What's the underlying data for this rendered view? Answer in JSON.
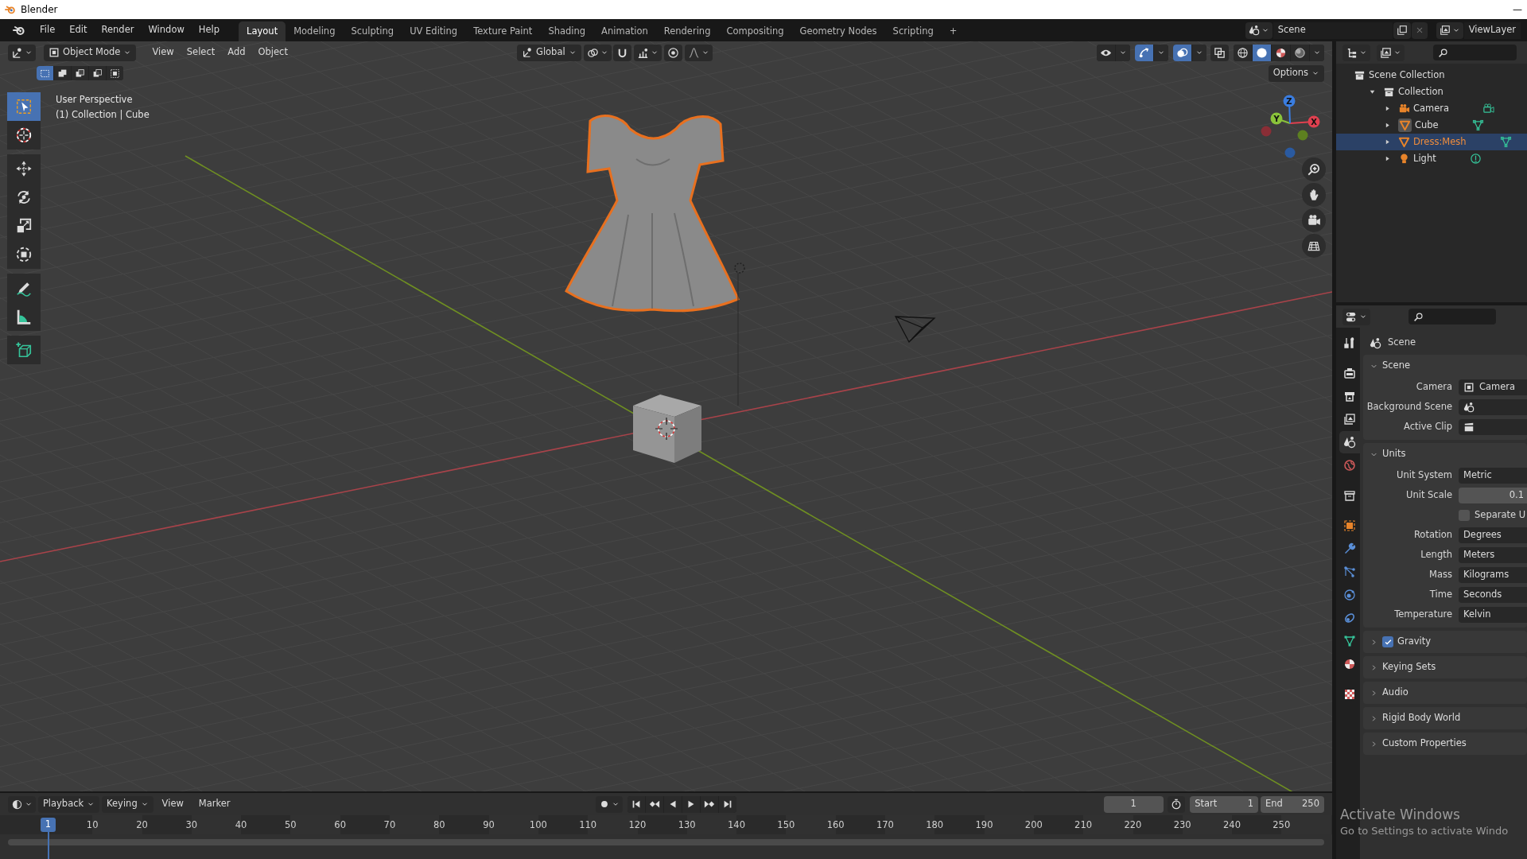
{
  "window": {
    "title": "Blender",
    "minimize": "—"
  },
  "menu_bar": {
    "menus": [
      "File",
      "Edit",
      "Render",
      "Window",
      "Help"
    ],
    "workspaces": [
      {
        "label": "Layout",
        "selected": true
      },
      {
        "label": "Modeling",
        "selected": false
      },
      {
        "label": "Sculpting",
        "selected": false
      },
      {
        "label": "UV Editing",
        "selected": false
      },
      {
        "label": "Texture Paint",
        "selected": false
      },
      {
        "label": "Shading",
        "selected": false
      },
      {
        "label": "Animation",
        "selected": false
      },
      {
        "label": "Rendering",
        "selected": false
      },
      {
        "label": "Compositing",
        "selected": false
      },
      {
        "label": "Geometry Nodes",
        "selected": false
      },
      {
        "label": "Scripting",
        "selected": false
      }
    ],
    "add_workspace": "+",
    "scene": "Scene",
    "view_layer": "ViewLayer"
  },
  "viewport": {
    "header": {
      "mode": "Object Mode",
      "menus": [
        "View",
        "Select",
        "Add",
        "Object"
      ],
      "orientation": "Global",
      "toggles": [
        {
          "kind": "visibility",
          "selected": false
        },
        {
          "kind": "gizmo",
          "selected": true
        },
        {
          "kind": "overlay",
          "selected": true
        },
        {
          "kind": "xray",
          "selected": false
        }
      ],
      "shading": [
        {
          "kind": "wireframe",
          "selected": false
        },
        {
          "kind": "solid",
          "selected": true
        },
        {
          "kind": "material",
          "selected": false
        },
        {
          "kind": "rendered",
          "selected": false
        }
      ],
      "select_modes": [
        {
          "kind": "set",
          "selected": true
        },
        {
          "kind": "extend",
          "selected": false
        },
        {
          "kind": "subtract",
          "selected": false
        },
        {
          "kind": "difference",
          "selected": false
        },
        {
          "kind": "intersect",
          "selected": false
        }
      ],
      "options": "Options"
    },
    "overlay_text": [
      "User Perspective",
      "(1) Collection | Cube"
    ],
    "tools": [
      {
        "kind": "select",
        "selected": true
      },
      {
        "kind": "cursor",
        "selected": false
      },
      {
        "kind": "move",
        "selected": false
      },
      {
        "kind": "rotate",
        "selected": false
      },
      {
        "kind": "scale",
        "selected": false
      },
      {
        "kind": "transform",
        "selected": false
      },
      {
        "kind": "annotate",
        "selected": false
      },
      {
        "kind": "measure",
        "selected": false
      },
      {
        "kind": "add_cube",
        "selected": false
      }
    ],
    "gizmo_axes": [
      "X",
      "Y",
      "Z"
    ]
  },
  "timeline": {
    "menus": [
      {
        "label": "Playback",
        "kind": "dropdown"
      },
      {
        "label": "Keying",
        "kind": "dropdown"
      },
      {
        "label": "View",
        "kind": "menu"
      },
      {
        "label": "Marker",
        "kind": "menu"
      }
    ],
    "frame": "1",
    "start_label": "Start",
    "start": "1",
    "end_label": "End",
    "end": "250",
    "ruler": {
      "current": "1",
      "labels": [
        "10",
        "20",
        "30",
        "40",
        "50",
        "60",
        "70",
        "80",
        "90",
        "100",
        "110",
        "120",
        "130",
        "140",
        "150",
        "160",
        "170",
        "180",
        "190",
        "200",
        "210",
        "220",
        "230",
        "240",
        "250"
      ]
    }
  },
  "outliner": {
    "tree": [
      {
        "label": "Scene Collection",
        "kind": "scene_collection",
        "children": [
          {
            "label": "Collection",
            "kind": "collection",
            "expanded": true,
            "children": [
              {
                "label": "Camera",
                "kind": "camera",
                "expanded": false,
                "selected": false,
                "active": false
              },
              {
                "label": "Cube",
                "kind": "mesh",
                "expanded": false,
                "selected": false,
                "active": true
              },
              {
                "label": "Dress:Mesh",
                "kind": "mesh",
                "expanded": false,
                "selected": true,
                "active": false
              },
              {
                "label": "Light",
                "kind": "light",
                "expanded": false,
                "selected": false,
                "active": false
              }
            ]
          }
        ]
      }
    ]
  },
  "properties": {
    "tabs": [
      {
        "kind": "tool",
        "selected": false
      },
      {
        "kind": "render",
        "selected": false
      },
      {
        "kind": "output",
        "selected": false
      },
      {
        "kind": "view_layer",
        "selected": false
      },
      {
        "kind": "scene",
        "selected": true
      },
      {
        "kind": "world",
        "selected": false
      },
      {
        "kind": "collection",
        "selected": false
      },
      {
        "kind": "object",
        "selected": false
      },
      {
        "kind": "modifiers",
        "selected": false
      },
      {
        "kind": "particles",
        "selected": false
      },
      {
        "kind": "physics",
        "selected": false
      },
      {
        "kind": "constraints",
        "selected": false
      },
      {
        "kind": "data",
        "selected": false
      },
      {
        "kind": "material",
        "selected": false
      },
      {
        "kind": "texture",
        "selected": false
      }
    ],
    "context": "Scene",
    "panels": [
      {
        "title": "Scene",
        "expanded": true,
        "rows": [
          {
            "kind": "field",
            "label": "Camera",
            "value": "Camera"
          },
          {
            "kind": "field",
            "label": "Background Scene"
          },
          {
            "kind": "field",
            "label": "Active Clip"
          }
        ]
      },
      {
        "title": "Units",
        "expanded": true,
        "rows": [
          {
            "kind": "field",
            "label": "Unit System",
            "value": "Metric"
          },
          {
            "kind": "number",
            "label": "Unit Scale",
            "value": "0.1"
          },
          {
            "kind": "checkbox",
            "label": "Separate U",
            "checked": false
          },
          {
            "kind": "field",
            "label": "Rotation",
            "value": "Degrees"
          },
          {
            "kind": "field",
            "label": "Length",
            "value": "Meters"
          },
          {
            "kind": "field",
            "label": "Mass",
            "value": "Kilograms"
          },
          {
            "kind": "field",
            "label": "Time",
            "value": "Seconds"
          },
          {
            "kind": "field",
            "label": "Temperature",
            "value": "Kelvin"
          }
        ]
      },
      {
        "title": "Gravity",
        "expanded": false,
        "checked": true
      },
      {
        "title": "Keying Sets",
        "expanded": false
      },
      {
        "title": "Audio",
        "expanded": false
      },
      {
        "title": "Rigid Body World",
        "expanded": false
      },
      {
        "title": "Custom Properties",
        "expanded": false
      }
    ]
  },
  "os_notice": {
    "title": "Activate Windows",
    "text": "Go to Settings to activate Windo"
  }
}
